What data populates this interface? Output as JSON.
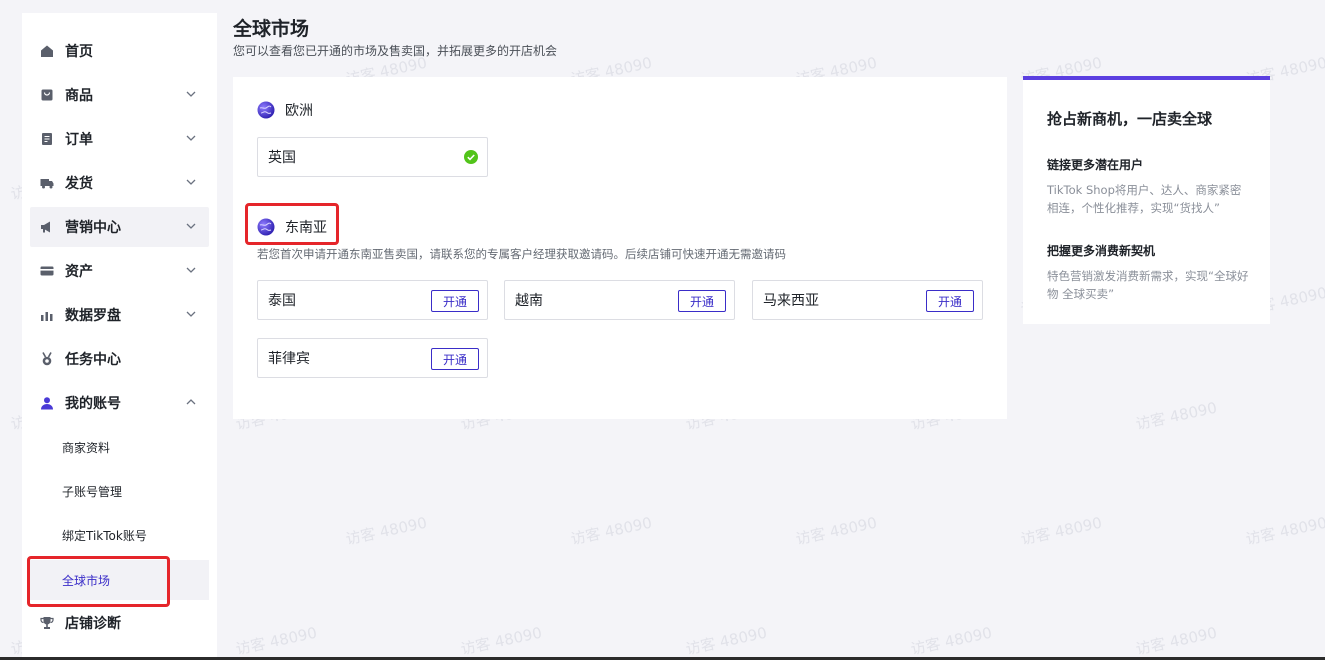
{
  "sidebar": {
    "items": [
      {
        "label": "首页",
        "icon": "home-icon"
      },
      {
        "label": "商品",
        "icon": "product-icon"
      },
      {
        "label": "订单",
        "icon": "order-icon"
      },
      {
        "label": "发货",
        "icon": "truck-icon"
      },
      {
        "label": "营销中心",
        "icon": "megaphone-icon"
      },
      {
        "label": "资产",
        "icon": "card-icon"
      },
      {
        "label": "数据罗盘",
        "icon": "chart-icon"
      },
      {
        "label": "任务中心",
        "icon": "medal-icon"
      },
      {
        "label": "我的账号",
        "icon": "user-icon"
      },
      {
        "label": "店铺诊断",
        "icon": "trophy-icon"
      }
    ],
    "sub_items": [
      {
        "label": "商家资料"
      },
      {
        "label": "子账号管理"
      },
      {
        "label": "绑定TikTok账号"
      },
      {
        "label": "全球市场"
      }
    ]
  },
  "header": {
    "title": "全球市场",
    "subtitle": "您可以查看您已开通的市场及售卖国，并拓展更多的开店机会"
  },
  "regions": {
    "europe": {
      "name": "欧洲",
      "countries": [
        {
          "name": "英国",
          "status": "已开通"
        }
      ]
    },
    "sea": {
      "name": "东南亚",
      "note": "若您首次申请开通东南亚售卖国，请联系您的专属客户经理获取邀请码。后续店铺可快速开通无需邀请码",
      "countries": [
        {
          "name": "泰国",
          "action": "开通"
        },
        {
          "name": "越南",
          "action": "开通"
        },
        {
          "name": "马来西亚",
          "action": "开通"
        },
        {
          "name": "菲律宾",
          "action": "开通"
        }
      ]
    }
  },
  "promo": {
    "title": "抢占新商机，一店卖全球",
    "sections": [
      {
        "heading": "链接更多潜在用户",
        "text": "TikTok Shop将用户、达人、商家紧密相连，个性化推荐，实现“货找人”"
      },
      {
        "heading": "把握更多消费新契机",
        "text": "特色营销激发消费新需求，实现“全球好物 全球买卖”"
      }
    ]
  },
  "watermark": "访客 48090",
  "colors": {
    "accent": "#3a2dc8",
    "success": "#52c41a",
    "highlight": "#e5252a",
    "promo_bar": "#5b3fe0"
  }
}
